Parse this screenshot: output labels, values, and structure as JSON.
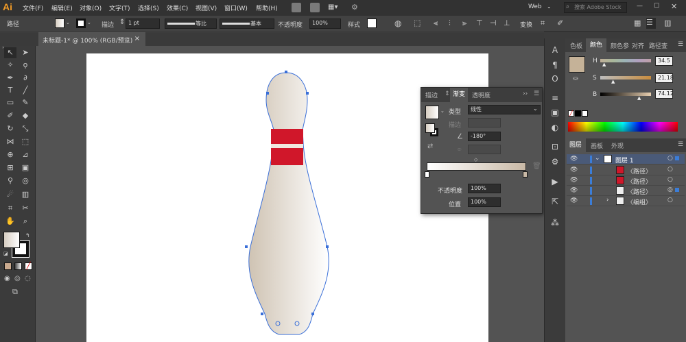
{
  "app": {
    "logo": "Ai"
  },
  "menu": [
    "文件(F)",
    "编辑(E)",
    "对象(O)",
    "文字(T)",
    "选择(S)",
    "效果(C)",
    "视图(V)",
    "窗口(W)",
    "帮助(H)"
  ],
  "topright": {
    "workspace": "Web",
    "search_placeholder": "搜索 Adobe Stock"
  },
  "control": {
    "object": "路径",
    "stroke_label": "描边",
    "stroke_value": "1 pt",
    "profile": "等比",
    "brush": "基本",
    "opacity_label": "不透明度",
    "opacity": "100%",
    "style_label": "样式",
    "transform": "变换"
  },
  "document": {
    "tab": "未标题-1* @ 100% (RGB/预览)",
    "close": "×"
  },
  "gradient_panel": {
    "tabs": [
      "描边",
      "渐变",
      "透明度"
    ],
    "type_label": "类型",
    "type_value": "线性",
    "stroke_label": "描边",
    "angle": "-180°",
    "opacity_label": "不透明度",
    "opacity": "100%",
    "location_label": "位置",
    "location": "100%"
  },
  "color_panel": {
    "tabs": [
      "色板",
      "颜色",
      "颜色参",
      "对齐",
      "路径查"
    ],
    "h_label": "H",
    "s_label": "S",
    "b_label": "B",
    "h": "34.5",
    "s": "21.18",
    "b": "74.12"
  },
  "layers_panel": {
    "tabs": [
      "图层",
      "画板",
      "外观"
    ],
    "rows": [
      "图层 1",
      "〈路径〉",
      "〈路径〉",
      "〈路径〉",
      "〈编组〉"
    ]
  },
  "colors": {
    "accent": "#3b7dd8",
    "pin_red": "#d0172a",
    "pin_base": "#d6cdc1"
  }
}
